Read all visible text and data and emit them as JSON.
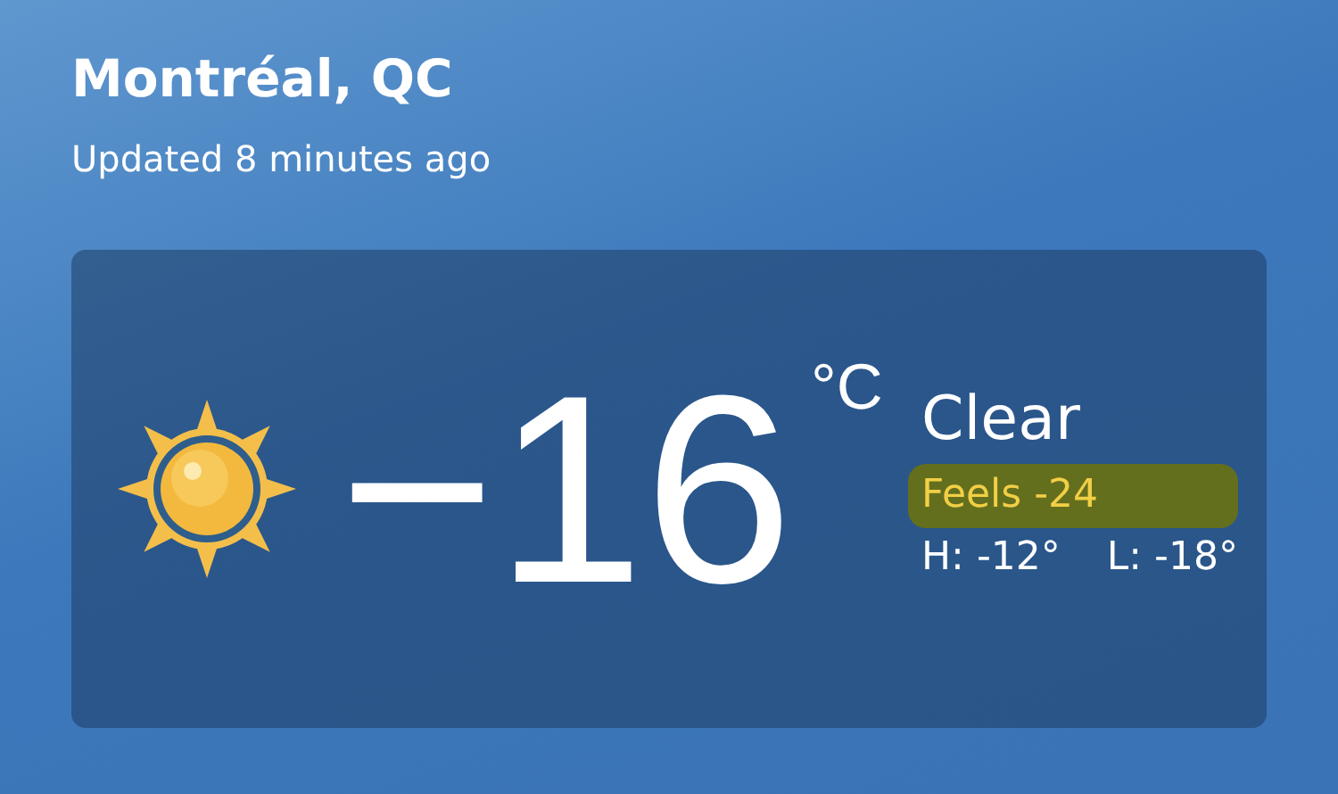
{
  "location": {
    "title": "Montréal, QC",
    "updated": "Updated 8 minutes ago"
  },
  "current": {
    "kind": "sunny",
    "temperature": "−16",
    "unit": "°C",
    "condition": "Clear",
    "feels": {
      "text": "Feels -24",
      "highlighted": true
    },
    "high": "H: -12°",
    "low": "L: -18°"
  }
}
